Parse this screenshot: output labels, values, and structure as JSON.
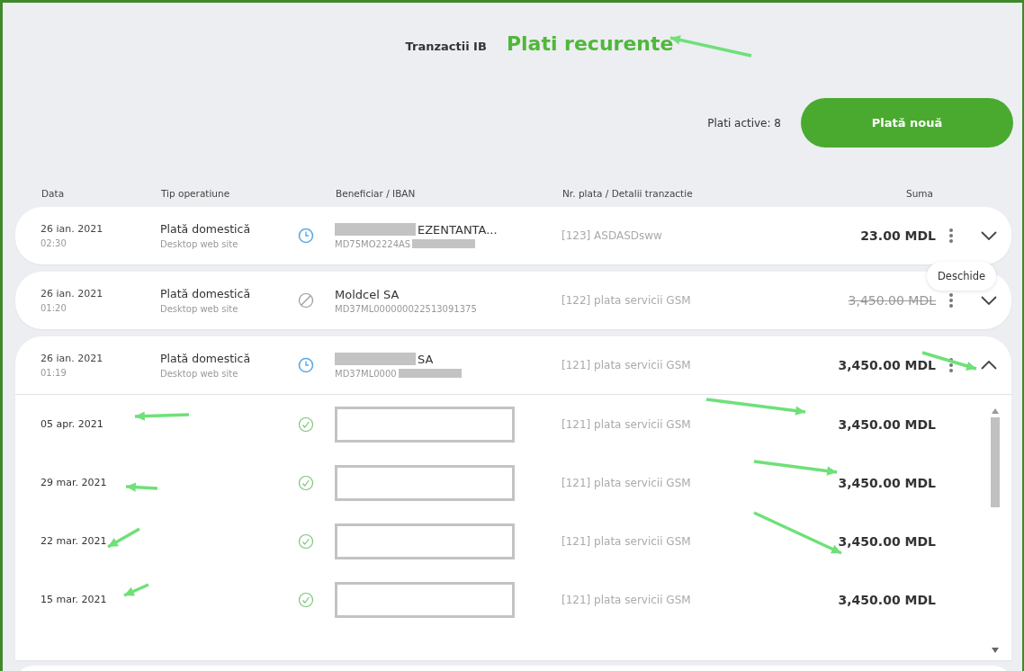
{
  "header": {
    "title": "Tranzactii IB",
    "annotation": "Plati recurente"
  },
  "summary": {
    "active_label": "Plati active: 8",
    "new_button": "Plată nouă"
  },
  "columns": [
    "Data",
    "Tip operatiune",
    "Beneficiar / IBAN",
    "Nr. plata / Detalii tranzactie",
    "Suma"
  ],
  "payments": [
    {
      "date": "26 ian. 2021",
      "time": "02:30",
      "type": "Plată domestică",
      "channel": "Desktop web site",
      "kind": "scheduled",
      "beneficiary": "EZENTANTA...",
      "iban": "MD75MO2224AS",
      "redacted": true,
      "details": "[123] ASDASDsww",
      "amount": "23.00 MDL",
      "cancelled": false,
      "expanded": false,
      "tooltip": "Deschide"
    },
    {
      "date": "26 ian. 2021",
      "time": "01:20",
      "type": "Plată domestică",
      "channel": "Desktop web site",
      "kind": "cancelled",
      "beneficiary": "Moldcel SA",
      "iban": "MD37ML000000022513091375",
      "redacted": false,
      "details": "[122] plata servicii GSM",
      "amount": "3,450.00 MDL",
      "cancelled": true,
      "expanded": false
    },
    {
      "date": "26 ian. 2021",
      "time": "01:19",
      "type": "Plată domestică",
      "channel": "Desktop web site",
      "kind": "scheduled",
      "beneficiary": "SA",
      "iban": "MD37ML0000",
      "redacted": true,
      "details": "[121] plata servicii GSM",
      "amount": "3,450.00 MDL",
      "cancelled": false,
      "expanded": true,
      "history": [
        {
          "date": "05 apr. 2021",
          "kind": "done",
          "details": "[121] plata servicii GSM",
          "amount": "3,450.00 MDL"
        },
        {
          "date": "29 mar. 2021",
          "kind": "done",
          "details": "[121] plata servicii GSM",
          "amount": "3,450.00 MDL"
        },
        {
          "date": "22 mar. 2021",
          "kind": "done",
          "details": "[121] plata servicii GSM",
          "amount": "3,450.00 MDL"
        },
        {
          "date": "15 mar. 2021",
          "kind": "done",
          "details": "[121] plata servicii GSM",
          "amount": "3,450.00 MDL"
        }
      ]
    }
  ]
}
